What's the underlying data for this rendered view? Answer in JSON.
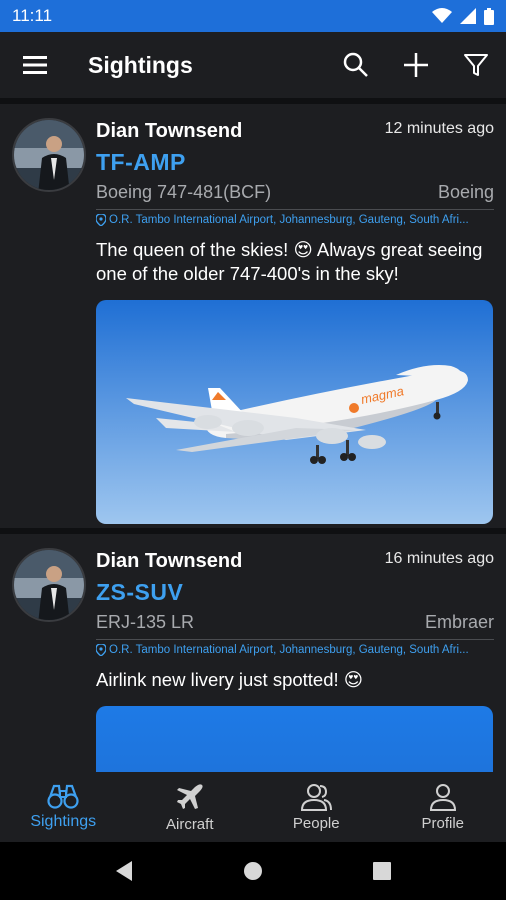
{
  "status_bar": {
    "time": "11:11"
  },
  "app_bar": {
    "title": "Sightings"
  },
  "posts": [
    {
      "user": "Dian Townsend",
      "time_ago": "12 minutes ago",
      "registration": "TF-AMP",
      "aircraft_type": "Boeing 747-481(BCF)",
      "manufacturer": "Boeing",
      "location": "O.R. Tambo International Airport, Johannesburg, Gauteng, South Afri...",
      "caption": "The queen of the skies! 😍 Always great seeing one of the older 747-400's in the sky!",
      "airline_livery_text": "magma"
    },
    {
      "user": "Dian Townsend",
      "time_ago": "16 minutes ago",
      "registration": "ZS-SUV",
      "aircraft_type": "ERJ-135 LR",
      "manufacturer": "Embraer",
      "location": "O.R. Tambo International Airport, Johannesburg, Gauteng, South Afri...",
      "caption": "Airlink new livery just spotted! 😍"
    }
  ],
  "bottom_nav": {
    "items": [
      {
        "label": "Sightings",
        "icon": "binoculars-icon",
        "active": true
      },
      {
        "label": "Aircraft",
        "icon": "airplane-icon",
        "active": false
      },
      {
        "label": "People",
        "icon": "people-icon",
        "active": false
      },
      {
        "label": "Profile",
        "icon": "person-icon",
        "active": false
      }
    ]
  },
  "colors": {
    "status_bar": "#1e6fd9",
    "surface": "#1d1e21",
    "background": "#0f1012",
    "accent": "#3ea0f0"
  }
}
